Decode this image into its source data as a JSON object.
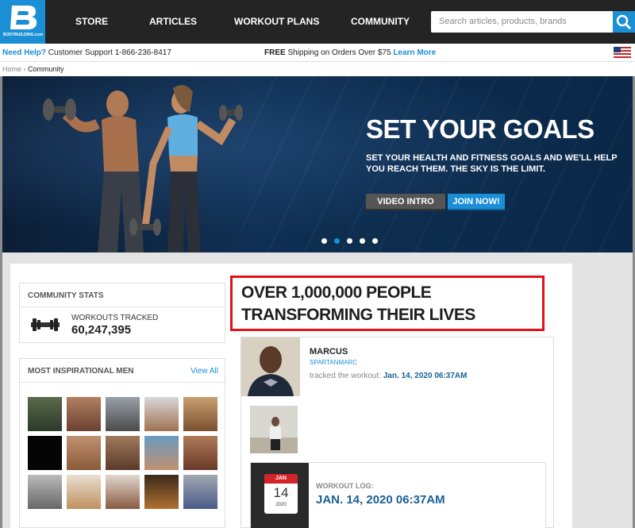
{
  "nav": {
    "logo_text": "BODYBUILDING.com",
    "items": [
      "STORE",
      "ARTICLES",
      "WORKOUT PLANS",
      "COMMUNITY"
    ],
    "search_placeholder": "Search articles, products, brands"
  },
  "infobar": {
    "help_label": "Need Help?",
    "help_text": " Customer Support 1-866-236-8417",
    "ship_bold": "FREE",
    "ship_text": " Shipping on Orders Over $75 ",
    "ship_link": "Learn More"
  },
  "breadcrumb": {
    "home": "Home",
    "sep": " › ",
    "current": "Community"
  },
  "hero": {
    "title": "SET YOUR GOALS",
    "subtitle": "SET YOUR HEALTH AND FITNESS GOALS AND WE'LL HELP YOU REACH THEM. THE SKY IS THE LIMIT.",
    "intro_button": "VIDEO INTRO",
    "join_button": "JOIN NOW!",
    "slides": 5,
    "active_slide": 2
  },
  "stats": {
    "heading": "COMMUNITY STATS",
    "label": "WORKOUTS TRACKED",
    "value": "60,247,395"
  },
  "inspirational": {
    "heading": "MOST INSPIRATIONAL MEN",
    "view_all": "View All"
  },
  "headline": "OVER 1,000,000 PEOPLE TRANSFORMING THEIR LIVES",
  "feed": {
    "name": "MARCUS",
    "handle": "SPARTANMARC",
    "tracked_text": "tracked the workout: ",
    "tracked_date": "Jan. 14, 2020 06:37AM",
    "log_label": "WORKOUT LOG:",
    "log_date": "JAN. 14, 2020 06:37AM",
    "cal_month": "JAN",
    "cal_day": "14",
    "cal_year": "2020"
  },
  "colors": {
    "brand_blue": "#1a8fd6",
    "highlight_red": "#e0131a",
    "nav_bg": "#242424"
  }
}
